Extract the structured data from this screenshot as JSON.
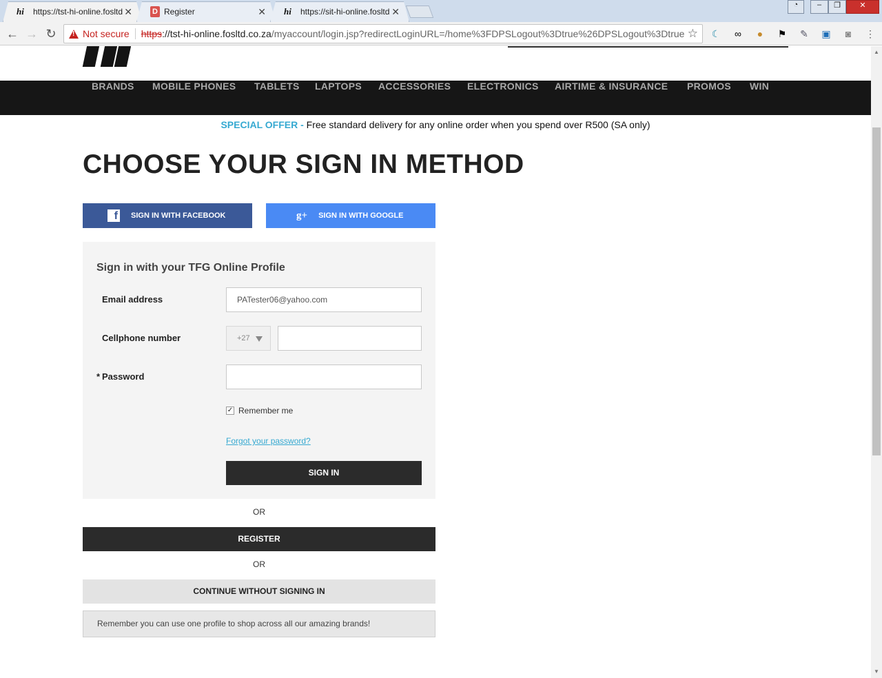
{
  "browser": {
    "tabs": [
      {
        "title": "https://tst-hi-online.fosltd.co.za",
        "favicon": "hi-logo-icon"
      },
      {
        "title": "Register",
        "favicon": "d-logo-icon"
      },
      {
        "title": "https://sit-hi-online.fosltd.co.za",
        "favicon": "hi-logo-icon"
      }
    ],
    "security_label": "Not secure",
    "url_scheme": "https",
    "url_host": "://tst-hi-online.fosltd.co.za",
    "url_path": "/myaccount/login.jsp?redirectLoginURL=/home%3FDPSLogout%3Dtrue%26DPSLogout%3Dtrue"
  },
  "nav": {
    "items": [
      "BRANDS",
      "MOBILE PHONES",
      "TABLETS",
      "LAPTOPS",
      "ACCESSORIES",
      "ELECTRONICS",
      "AIRTIME & INSURANCE",
      "PROMOS",
      "WIN"
    ]
  },
  "offer": {
    "label": "SPECIAL OFFER -",
    "text": " Free standard delivery for any online order when you spend over R500 (SA only)"
  },
  "page": {
    "title": "CHOOSE YOUR SIGN IN METHOD"
  },
  "social": {
    "facebook_label": "SIGN IN WITH FACEBOOK",
    "google_label": "SIGN IN WITH GOOGLE"
  },
  "form": {
    "title": "Sign in with your TFG Online Profile",
    "email_label": "Email address",
    "email_value": "PATester06@yahoo.com",
    "cell_label": "Cellphone number",
    "country_code": "+27",
    "cell_value": "",
    "password_label": "Password",
    "required_mark": "*",
    "password_value": "",
    "remember_label": "Remember me",
    "remember_checked": true,
    "forgot_label": "Forgot your password?",
    "signin_label": "SIGN IN"
  },
  "alternatives": {
    "or_1": "OR",
    "register_label": "REGISTER",
    "or_2": "OR",
    "guest_label": "CONTINUE WITHOUT SIGNING IN",
    "notice": "Remember you can use one profile to shop across all our amazing brands!"
  },
  "colors": {
    "accent": "#36a9d1",
    "facebook": "#3b5998",
    "google": "#4a8af4",
    "nav_bg": "#161616",
    "button_dark": "#2b2b2b"
  }
}
